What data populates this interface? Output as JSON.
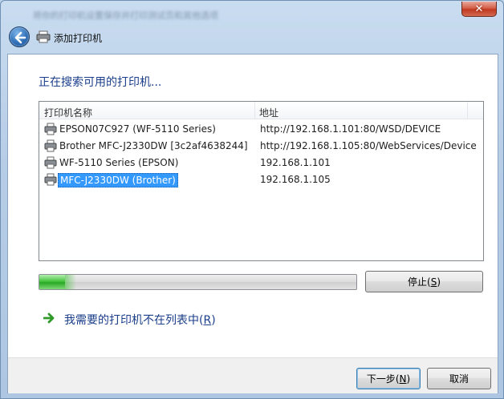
{
  "window": {
    "blurred_caption": "将你的打印机设置保存并打印测试页和其他选项",
    "close_glyph": "✕",
    "title": "添加打印机"
  },
  "main": {
    "heading": "正在搜索可用的打印机..."
  },
  "printer_list": {
    "columns": [
      "打印机名称",
      "地址"
    ],
    "rows": [
      {
        "name": "EPSON07C927 (WF-5110 Series)",
        "address": "http://192.168.1.101:80/WSD/DEVICE",
        "selected": false
      },
      {
        "name": "Brother MFC-J2330DW [3c2af4638244]",
        "address": "http://192.168.1.105:80/WebServices/Device",
        "selected": false
      },
      {
        "name": "WF-5110 Series (EPSON)",
        "address": "192.168.1.101",
        "selected": false
      },
      {
        "name": "MFC-J2330DW (Brother)",
        "address": "192.168.1.105",
        "selected": true
      }
    ]
  },
  "search_progress": {
    "percent": 8
  },
  "buttons": {
    "stop_label": "停止",
    "stop_accel": "S",
    "next_label": "下一步",
    "next_accel": "N",
    "cancel_label": "取消"
  },
  "link": {
    "text": "我需要的打印机不在列表中",
    "accel": "R"
  },
  "colors": {
    "heading": "#1a3e8a",
    "selection": "#3399ff",
    "progress": "#2aa826"
  },
  "icons": {
    "back": "back-arrow-icon",
    "printer": "printer-icon",
    "link_arrow": "green-arrow-icon"
  }
}
